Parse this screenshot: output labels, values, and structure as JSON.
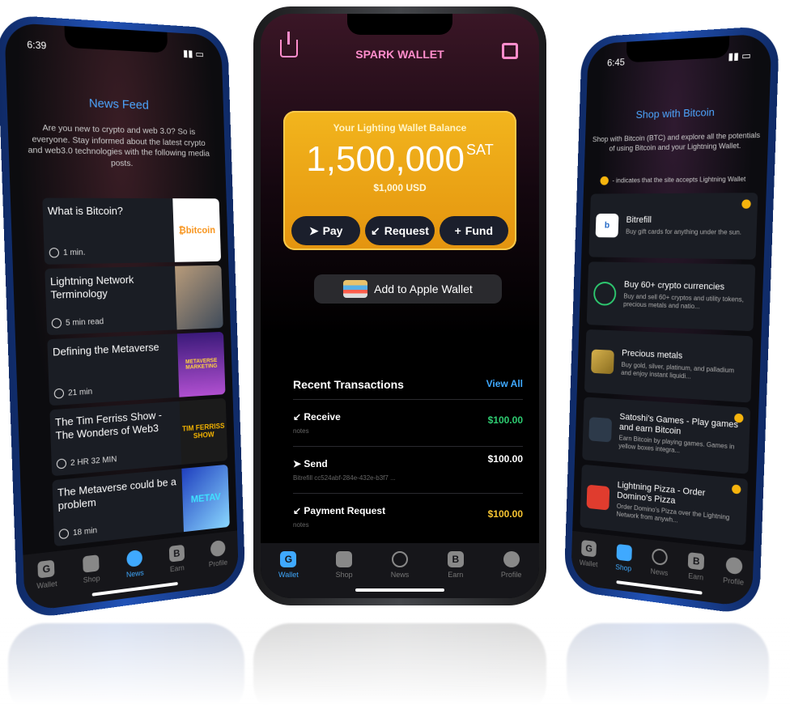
{
  "left": {
    "status_time": "6:39",
    "title": "News Feed",
    "intro": "Are you new to crypto and web 3.0? So is everyone. Stay informed about the latest crypto and web3.0 technologies with the following media posts.",
    "items": [
      {
        "title": "What is Bitcoin?",
        "meta": "1 min.",
        "thumb": "₿bitcoin"
      },
      {
        "title": "Lightning Network Terminology",
        "meta": "5 min read",
        "thumb": ""
      },
      {
        "title": "Defining the Metaverse",
        "meta": "21 min",
        "thumb": "METAVERSE MARKETING"
      },
      {
        "title": "The Tim Ferriss Show - The Wonders of Web3",
        "meta": "2 HR 32 MIN",
        "thumb": "TIM FERRISS SHOW"
      },
      {
        "title": "The Metaverse could be a problem",
        "meta": "18 min",
        "thumb": "METAV"
      }
    ],
    "tabs": [
      "Wallet",
      "Shop",
      "News",
      "Earn",
      "Profile"
    ]
  },
  "center": {
    "title": "SPARK WALLET",
    "balance_label": "Your Lighting Wallet Balance",
    "balance": "1,500,000",
    "unit": "SAT",
    "usd": "$1,000 USD",
    "buttons": [
      "Pay",
      "Request",
      "Fund"
    ],
    "apple_wallet": "Add to Apple Wallet",
    "recent": "Recent Transactions",
    "view_all": "View All",
    "transactions": [
      {
        "name": "Receive",
        "sub": "notes",
        "amount": "$100.00",
        "color": "#2ecc71"
      },
      {
        "name": "Send",
        "sub": "Bitrefill  cc524abf-284e-432e-b3f7 ...",
        "amount": "$100.00",
        "color": "#ffffff"
      },
      {
        "name": "Payment Request",
        "sub": "notes",
        "amount": "$100.00",
        "color": "#f6c431"
      }
    ],
    "tabs": [
      "Wallet",
      "Shop",
      "News",
      "Earn",
      "Profile"
    ]
  },
  "right": {
    "status_time": "6:45",
    "title": "Shop with Bitcoin",
    "intro": "Shop with Bitcoin (BTC) and explore all the potentials of using Bitcoin and your Lightning Wallet.",
    "indicator": "- indicates that the site accepts Lightning Wallet",
    "items": [
      {
        "name": "Bitrefill",
        "desc": "Buy gift cards for anything under the sun.",
        "logo": "b"
      },
      {
        "name": "Buy 60+ crypto currencies",
        "desc": "Buy and sell 60+ cryptos and utility tokens, precious metals and natio...",
        "logo": ""
      },
      {
        "name": "Precious metals",
        "desc": "Buy gold, silver, platinum, and palladium and enjoy instant liquidi...",
        "logo": ""
      },
      {
        "name": "Satoshi's Games - Play games and earn Bitcoin",
        "desc": "Earn Bitcoin by playing games. Games in yellow boxes integra...",
        "logo": ""
      },
      {
        "name": "Lightning Pizza - Order Domino's Pizza",
        "desc": "Order Domino's Pizza over the Lightning Network from anywh...",
        "logo": ""
      }
    ],
    "tabs": [
      "Wallet",
      "Shop",
      "News",
      "Earn",
      "Profile"
    ]
  }
}
